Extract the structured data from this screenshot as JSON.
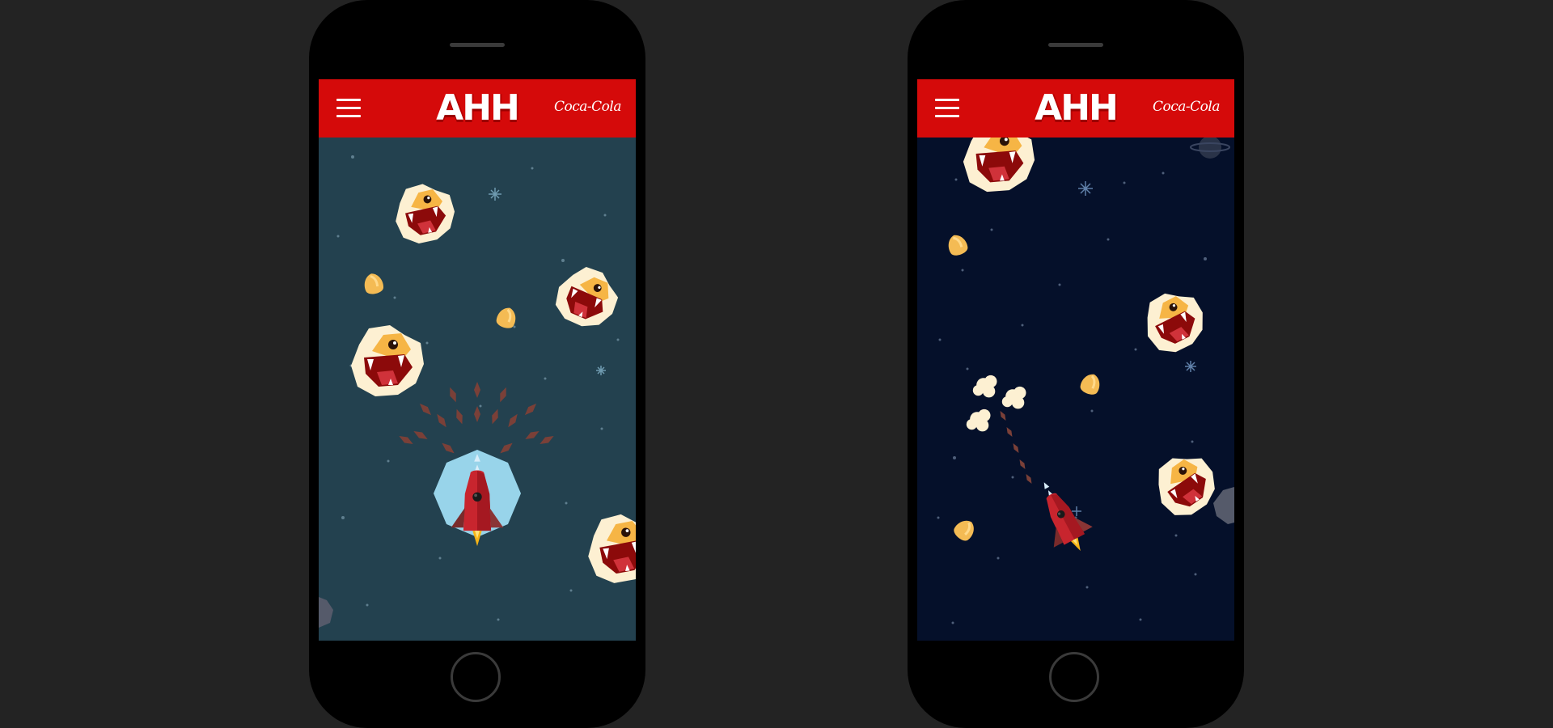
{
  "screens": [
    {
      "header": {
        "app_title": "AHH",
        "brand": "Coca-Cola"
      },
      "icons": {
        "menu": "hamburger-menu-icon"
      },
      "colors": {
        "header": "#d50a0a",
        "background": "#23414f",
        "shield": "#9fdcf2"
      }
    },
    {
      "header": {
        "app_title": "AHH",
        "brand": "Coca-Cola"
      },
      "icons": {
        "menu": "hamburger-menu-icon"
      },
      "colors": {
        "header": "#d50a0a",
        "background": "#05102a"
      }
    }
  ]
}
